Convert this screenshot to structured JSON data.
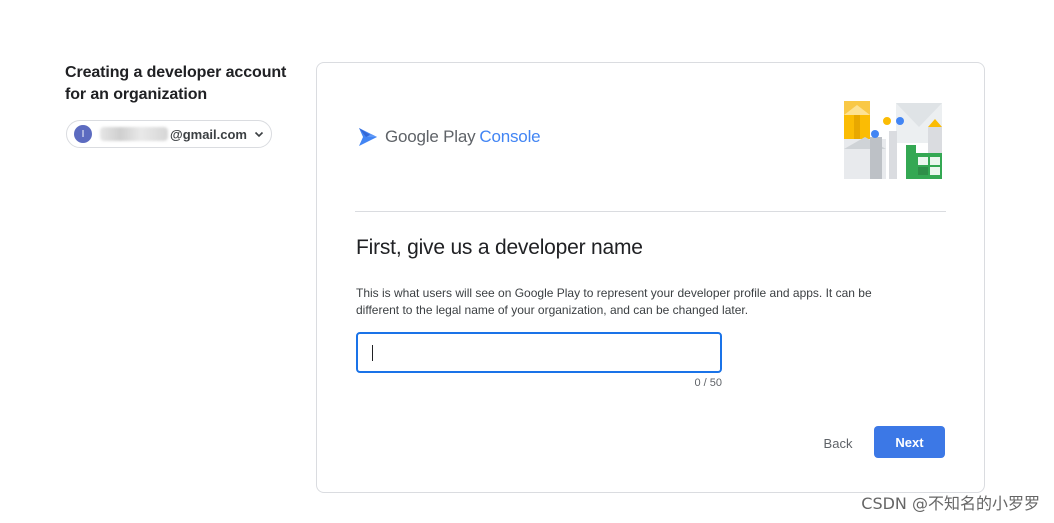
{
  "left": {
    "title": "Creating a developer account for an organization",
    "account": {
      "avatar_letter": "I",
      "email_suffix": "gmail.com"
    }
  },
  "logo": {
    "brand": "Google Play",
    "product": "Console",
    "icon": "google-play-console-logo"
  },
  "form": {
    "heading": "First, give us a developer name",
    "description": "This is what users will see on Google Play to represent your developer profile and apps. It can be different to the legal name of your organization, and can be changed later.",
    "input_value": "",
    "counter": "0 / 50"
  },
  "actions": {
    "back_label": "Back",
    "next_label": "Next"
  },
  "colors": {
    "primary": "#3c78e6",
    "focus": "#1a73e8",
    "brand_blue": "#4285f4"
  },
  "watermark": "CSDN @不知名的小罗罗"
}
